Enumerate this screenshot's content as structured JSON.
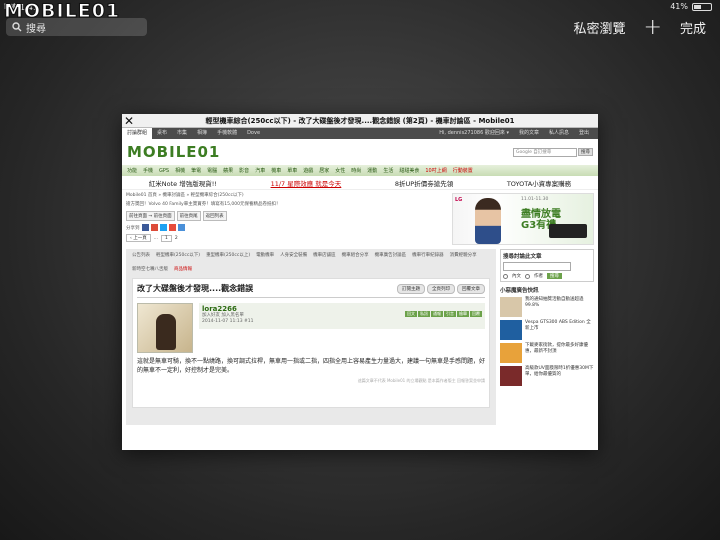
{
  "status": {
    "device": "iPad",
    "time": "下午1:41",
    "battery": "41%",
    "battery_level": 0.41
  },
  "watermark": "MOBILE01",
  "safari": {
    "search_placeholder": "搜尋",
    "private_label": "私密瀏覽",
    "plus_label": "+",
    "done_label": "完成"
  },
  "tab": {
    "close_label": "✕",
    "title": "輕型機車綜合(250cc以下) - 改了大碟盤後才發現....觀念錯誤 (第2頁) - 機車討論區 - Mobile01"
  },
  "page": {
    "nav1": [
      "討論群組",
      "桌布",
      "市集",
      "相簿",
      "手機軟體",
      "Dove"
    ],
    "nav1_right": [
      "Hi, dennis271086 歡迎回來 ▾",
      "我的文章",
      "私人訊息",
      "登出"
    ],
    "logo": "MOBILE01",
    "google_placeholder": "Google 自訂搜尋",
    "google_btn": "搜尋",
    "nav2": [
      "功能",
      "手機",
      "GPS",
      "相機",
      "筆電",
      "電腦",
      "蘋果",
      "影音",
      "汽車",
      "機車",
      "單車",
      "遊戲",
      "居家",
      "女性",
      "時尚",
      "運動",
      "生活",
      "甜甜美食",
      "10吋上網",
      "行動裝置"
    ],
    "promo": [
      {
        "text": "紅米Note 增強版現貨!!",
        "red": false
      },
      {
        "text": "11/7 星際效應 就是今天",
        "red": true
      },
      {
        "text": "8折UP折價劵搶先領",
        "red": false
      },
      {
        "text": "TOYOTA小資專案購務",
        "red": false
      }
    ],
    "breadcrumb": "Mobile01 首頁 » 機車討論區 » 輕型機車綜合(250cc以下)",
    "notice": "搶方獎回！Volvo 40 Family車主獎賞券！填寫有15,000元保養精品卷抵扣！",
    "buttons": [
      "前往頁面 → 前往頁面",
      "前往頁尾",
      "返回列表"
    ],
    "share_label": "分享到",
    "pager": {
      "prev": "‹ 上一頁",
      "dots": "...",
      "p1": "1",
      "p2": "2"
    },
    "ad": {
      "brand": "LG",
      "small": "11.01-11.30",
      "big1": "盡情放電",
      "big2": "G3有禮"
    },
    "subnav": [
      "公告列表",
      "輕型機車(250cc以下)",
      "重型機車(250cc以上)",
      "電動機車",
      "人身安全裝備",
      "機車店舖區",
      "機車組合分享",
      "機車廣告討論區",
      "機車行車紀錄器",
      "消費經驗分享",
      "新時空七嘴八舌版",
      "商品情報"
    ],
    "post": {
      "title": "改了大碟盤後才發現....觀念錯誤",
      "btns": [
        "訂閱主題",
        "全頁列印",
        "回覆文章"
      ],
      "username": "lora2266",
      "meta1": "加入好友  加入黑名單",
      "meta2": "2014-11-07 11:13  #11",
      "tags": [
        "回文",
        "私訊",
        "通報",
        "引言",
        "檢舉",
        "回覆"
      ],
      "text": "這就是無車可騎，換不一點繞路，換可調式拉桿，無車用一指或二指，四指全用上容易產生力量過大，建議一句無車是手感問題，好的無車不一定利，好控制才是完美。",
      "sig": "這篇文章不代表 Mobile01 的立場觀點 是本篇作者版主 回報答案並申請"
    },
    "side": {
      "search_title": "搜尋討論此文章",
      "radio1": "內文",
      "radio2": "作者",
      "search_btn": "搜尋",
      "ads_title": "小惡魔廣告快訊",
      "ads": [
        {
          "text": "我的通知抽獎活動自動送超過99.8%",
          "color": "#d8c7a9"
        },
        {
          "text": "Vespa GTS300 ABS Edition 全新上市",
          "color": "#1f5fa0"
        },
        {
          "text": "下載麥家街款，提你最多好康優惠，最新不封頂",
          "color": "#e8a23a"
        },
        {
          "text": "高級款UV面膜限時1折優惠30M下單，給你最優質的",
          "color": "#7a2a2a"
        }
      ]
    }
  },
  "colors": {
    "green": "#3d7d23",
    "red": "#cc0000",
    "dark_bg": "#2e2e2e"
  }
}
